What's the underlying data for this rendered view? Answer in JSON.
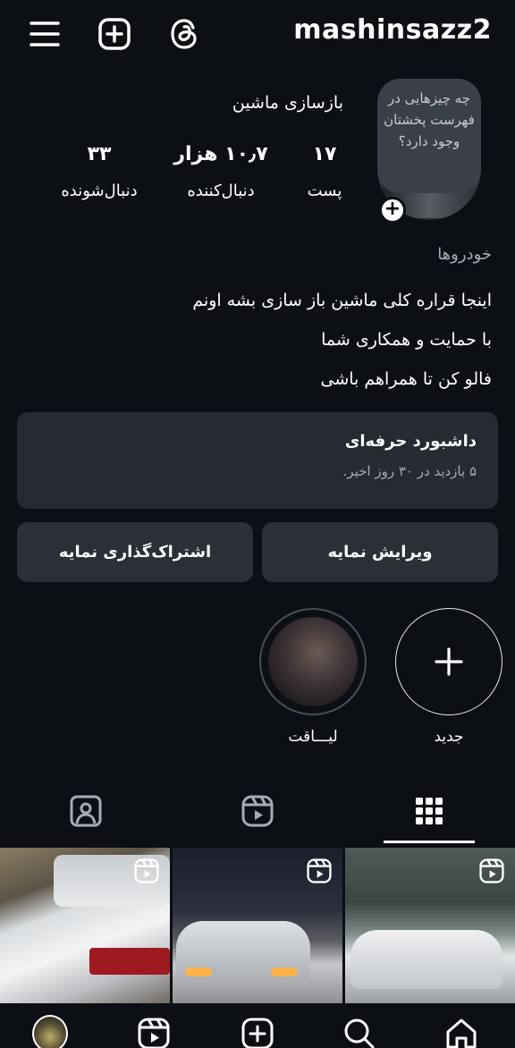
{
  "header": {
    "username": "mashinsazz2",
    "icons": [
      "menu-icon",
      "add-icon",
      "threads-icon"
    ]
  },
  "profile": {
    "note": "چه چیزهایی در فهرست پخشتان وجود دارد؟",
    "full_name": "بازسازی ماشین",
    "stats": {
      "posts": {
        "value": "۱۷",
        "label": "پست"
      },
      "followers": {
        "value": "۱۰٫۷ هزار",
        "label": "دنبال‌کننده"
      },
      "following": {
        "value": "۳۳",
        "label": "دنبال‌شونده"
      }
    },
    "category": "خودروها",
    "bio": [
      "اینجا قراره کلی ماشین باز سازی بشه اونم",
      "با حمایت و همکاری شما",
      "فالو کن تا همراهم باشی"
    ]
  },
  "dashboard": {
    "title": "داشبورد حرفه‌ای",
    "subtitle": "۵ بازدید در ۳۰ روز اخیر."
  },
  "buttons": {
    "edit_profile": "ویرایش نمایه",
    "share_profile": "اشتراک‌گذاری نمایه"
  },
  "highlights": [
    {
      "label": "جدید",
      "icon": "plus-icon"
    },
    {
      "label": "لیـــاقت"
    }
  ],
  "tabs": {
    "active": "grid",
    "items": [
      "grid-icon",
      "reels-icon",
      "tagged-icon"
    ]
  },
  "posts": [
    {
      "type": "reel",
      "icon": "reels-icon"
    },
    {
      "type": "reel",
      "icon": "reels-icon"
    },
    {
      "type": "reel",
      "icon": "reels-icon"
    }
  ],
  "bottom_nav": [
    "home-icon",
    "search-icon",
    "create-icon",
    "reels-icon",
    "profile-avatar"
  ],
  "colors": {
    "background": "#0c0f14",
    "card": "#262a31",
    "button": "#2b2f36",
    "muted_text": "#a7acb3"
  }
}
